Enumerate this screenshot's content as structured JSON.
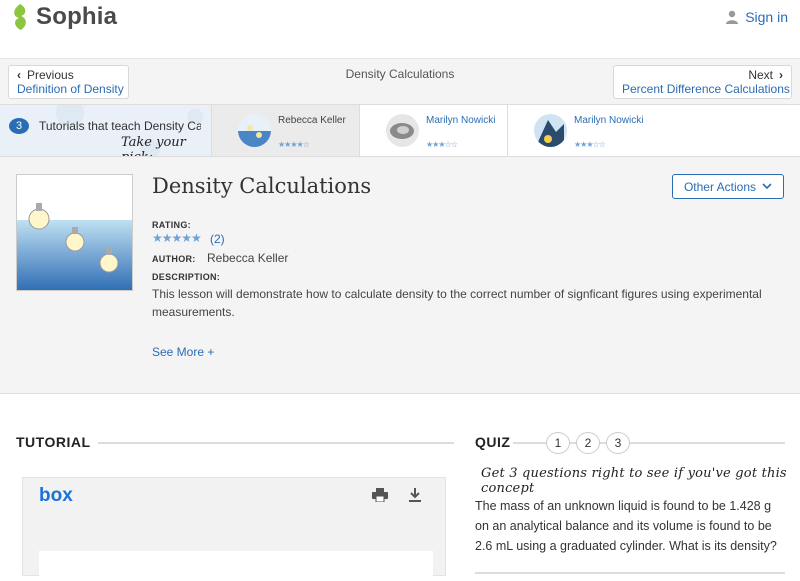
{
  "header": {
    "brand": "Sophia",
    "signin_label": "Sign in"
  },
  "nav": {
    "prev_small": "Previous",
    "prev_link": "Definition of Density",
    "title": "Density Calculations",
    "next_small": "Next",
    "next_link": "Percent Difference Calculations"
  },
  "tutorials_bar": {
    "count": "3",
    "label": "Tutorials that teach Density Calculations",
    "pick": "Take your pick:",
    "items": [
      {
        "author": "Rebecca Keller",
        "rating": 4.5
      },
      {
        "author": "Marilyn Nowicki",
        "rating": 3
      },
      {
        "author": "Marilyn Nowicki",
        "rating": 3
      }
    ]
  },
  "lesson": {
    "title": "Density Calculations",
    "other_actions_label": "Other Actions",
    "rating_label": "RATING:",
    "rating_stars": "★★★★★",
    "rating_count": "(2)",
    "author_label": "AUTHOR:",
    "author_value": "Rebecca Keller",
    "description_label": "DESCRIPTION:",
    "description": "This lesson will demonstrate how to calculate density to the correct number of signficant figures using experimental measurements.",
    "see_more": "See More +"
  },
  "tutorial_section": {
    "heading": "TUTORIAL",
    "box_brand": "box"
  },
  "quiz": {
    "heading": "QUIZ",
    "steps": [
      "1",
      "2",
      "3"
    ],
    "subtitle": "Get 3 questions right to see if you've got this concept",
    "question": "The mass of an unknown liquid is found to be 1.428 g on an analytical balance and its volume is found to be 2.6 mL using a graduated cylinder. What is its density?"
  },
  "colors": {
    "accent": "#2a6db5",
    "brand_green": "#8cc63f",
    "box_blue": "#1b73d6"
  }
}
